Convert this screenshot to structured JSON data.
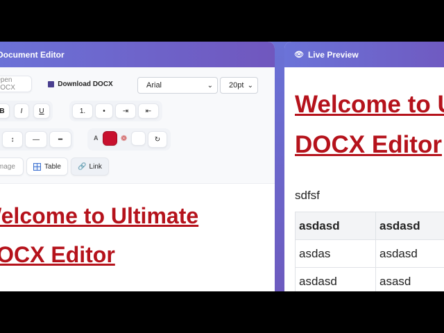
{
  "editor": {
    "title": "Document Editor",
    "toolbar": {
      "open_label": "Open DOCX",
      "download_label": "Download DOCX",
      "font_family": "Arial",
      "font_size": "20pt",
      "bold": "B",
      "italic": "I",
      "underline": "U",
      "ordered_list": "1.",
      "bullet_list": "•",
      "indent": "⇥",
      "outdent": "⇤",
      "line_height": "↕",
      "hr_thin": "―",
      "hr_thick": "━",
      "text_color_label": "A",
      "reset": "↻",
      "image_label": "Image",
      "table_label": "Table",
      "link_label": "Link",
      "text_color": "#c8102e"
    },
    "content": {
      "heading_line1": "Welcome to Ultimate",
      "heading_line2": "DOCX Editor"
    }
  },
  "preview": {
    "title": "Live Preview",
    "heading_line1": "Welcome to Ultimate",
    "heading_line2": "DOCX Editor",
    "paragraph": "sdfsf",
    "table": {
      "headers": [
        "asdasd",
        "asdasd"
      ],
      "rows": [
        [
          "asdas",
          "asdasd"
        ],
        [
          "asdasd",
          "asasd"
        ]
      ]
    }
  }
}
